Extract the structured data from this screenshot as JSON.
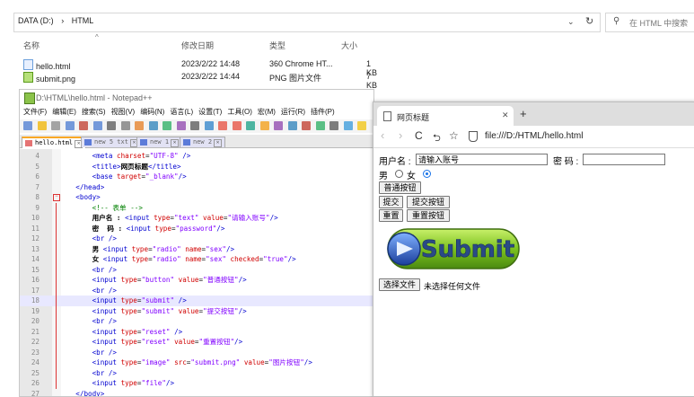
{
  "explorer": {
    "breadcrumb": [
      "DATA (D:)",
      "›",
      "HTML"
    ],
    "dropdown": "⌄",
    "refresh": "↻",
    "search_placeholder": "在 HTML 中搜索",
    "columns": {
      "name": "名称",
      "date": "修改日期",
      "type": "类型",
      "size": "大小"
    },
    "files": [
      {
        "name": "hello.html",
        "date": "2023/2/22 14:48",
        "type": "360 Chrome HT...",
        "size": "1 KB"
      },
      {
        "name": "submit.png",
        "date": "2023/2/22 14:44",
        "type": "PNG 图片文件",
        "size": "7 KB"
      }
    ]
  },
  "notepad": {
    "title": "D:\\HTML\\hello.html - Notepad++",
    "window_controls": [
      "–",
      "☐",
      "✕"
    ],
    "menu": [
      "文件(F)",
      "编辑(E)",
      "搜索(S)",
      "视图(V)",
      "编码(N)",
      "语言(L)",
      "设置(T)",
      "工具(O)",
      "宏(M)",
      "运行(R)",
      "插件(P)"
    ],
    "tabs": [
      {
        "label": "hello.html",
        "close": "✕"
      },
      {
        "label": "new 5 txt",
        "close": "✕"
      },
      {
        "label": "new 1",
        "close": "✕"
      },
      {
        "label": "new 2",
        "close": "✕"
      }
    ],
    "current_line": 18,
    "lines": [
      {
        "n": "4",
        "html": "        <span class='tg'>&lt;meta</span> <span class='at'>charset</span>=<span class='vl'>\"UTF-8\"</span> <span class='tg'>/&gt;</span>"
      },
      {
        "n": "5",
        "html": "        <span class='tg'>&lt;title&gt;</span><span class='tx'>网页标题</span><span class='tg'>&lt;/title&gt;</span>"
      },
      {
        "n": "6",
        "html": "        <span class='tg'>&lt;base</span> <span class='at'>target</span>=<span class='vl'>\"_blank\"</span><span class='tg'>/&gt;</span>"
      },
      {
        "n": "7",
        "html": "    <span class='tg'>&lt;/head&gt;</span>"
      },
      {
        "n": "8",
        "html": "    <span class='tg'>&lt;body&gt;</span>"
      },
      {
        "n": "9",
        "html": "        <span class='cm'>&lt;!-- 表单 --&gt;</span>"
      },
      {
        "n": "10",
        "html": "        <span class='tx'>用户名 :</span> <span class='tg'>&lt;input</span> <span class='at'>type</span>=<span class='vl'>\"text\"</span> <span class='at'>value</span>=<span class='vl'>\"请输入账号\"</span><span class='tg'>/&gt;</span>"
      },
      {
        "n": "11",
        "html": "        <span class='tx'>密  码 :</span> <span class='tg'>&lt;input</span> <span class='at'>type</span>=<span class='vl'>\"password\"</span><span class='tg'>/&gt;</span>"
      },
      {
        "n": "12",
        "html": "        <span class='tg'>&lt;br /&gt;</span>"
      },
      {
        "n": "13",
        "html": "        <span class='tx'>男</span> <span class='tg'>&lt;input</span> <span class='at'>type</span>=<span class='vl'>\"radio\"</span> <span class='at'>name</span>=<span class='vl'>\"sex\"</span><span class='tg'>/&gt;</span>"
      },
      {
        "n": "14",
        "html": "        <span class='tx'>女</span> <span class='tg'>&lt;input</span> <span class='at'>type</span>=<span class='vl'>\"radio\"</span> <span class='at'>name</span>=<span class='vl'>\"sex\"</span> <span class='at'>checked</span>=<span class='vl'>\"true\"</span><span class='tg'>/&gt;</span>"
      },
      {
        "n": "15",
        "html": "        <span class='tg'>&lt;br /&gt;</span>"
      },
      {
        "n": "16",
        "html": "        <span class='tg'>&lt;input</span> <span class='at'>type</span>=<span class='vl'>\"button\"</span> <span class='at'>value</span>=<span class='vl'>\"普通按钮\"</span><span class='tg'>/&gt;</span>"
      },
      {
        "n": "17",
        "html": "        <span class='tg'>&lt;br /&gt;</span>"
      },
      {
        "n": "18",
        "html": "        <span class='tg'>&lt;input</span> <span class='at'>type</span>=<span class='vl'>\"submit\"</span> <span class='tg'>/&gt;</span>"
      },
      {
        "n": "19",
        "html": "        <span class='tg'>&lt;input</span> <span class='at'>type</span>=<span class='vl'>\"submit\"</span> <span class='at'>value</span>=<span class='vl'>\"提交按钮\"</span><span class='tg'>/&gt;</span>"
      },
      {
        "n": "20",
        "html": "        <span class='tg'>&lt;br /&gt;</span>"
      },
      {
        "n": "21",
        "html": "        <span class='tg'>&lt;input</span> <span class='at'>type</span>=<span class='vl'>\"reset\"</span> <span class='tg'>/&gt;</span>"
      },
      {
        "n": "22",
        "html": "        <span class='tg'>&lt;input</span> <span class='at'>type</span>=<span class='vl'>\"reset\"</span> <span class='at'>value</span>=<span class='vl'>\"重置按钮\"</span><span class='tg'>/&gt;</span>"
      },
      {
        "n": "23",
        "html": "        <span class='tg'>&lt;br /&gt;</span>"
      },
      {
        "n": "24",
        "html": "        <span class='tg'>&lt;input</span> <span class='at'>type</span>=<span class='vl'>\"image\"</span> <span class='at'>src</span>=<span class='vl'>\"submit.png\"</span> <span class='at'>value</span>=<span class='vl'>\"图片按钮\"</span><span class='tg'>/&gt;</span>"
      },
      {
        "n": "25",
        "html": "        <span class='tg'>&lt;br /&gt;</span>"
      },
      {
        "n": "26",
        "html": "        <span class='tg'>&lt;input</span> <span class='at'>type</span>=<span class='vl'>\"file\"</span><span class='tg'>/&gt;</span>"
      },
      {
        "n": "27",
        "html": "    <span class='tg'>&lt;/body&gt;</span>"
      }
    ]
  },
  "chrome": {
    "tab_title": "网页标题",
    "tab_close": "✕",
    "new_tab": "+",
    "nav": {
      "back": "‹",
      "forward": "›",
      "reload": "C",
      "undo": "⮌",
      "star": "☆"
    },
    "url": "file:///D:/HTML/hello.html",
    "form": {
      "username_label": "用户名 :",
      "username_value": "请输入账号",
      "password_label": "密 码 :",
      "male_label": "男",
      "female_label": "女",
      "button_plain": "普通按钮",
      "button_submit": "提交",
      "button_submit_custom": "提交按钮",
      "button_reset": "重置",
      "button_reset_custom": "重置按钮",
      "image_button_text": "Submit",
      "file_button": "选择文件",
      "file_status": "未选择任何文件"
    }
  },
  "colors": {
    "tag": "#0000d0",
    "attr": "#d00000",
    "value": "#8000ff",
    "comment": "#008000",
    "submit_green": "#7cc21f"
  }
}
